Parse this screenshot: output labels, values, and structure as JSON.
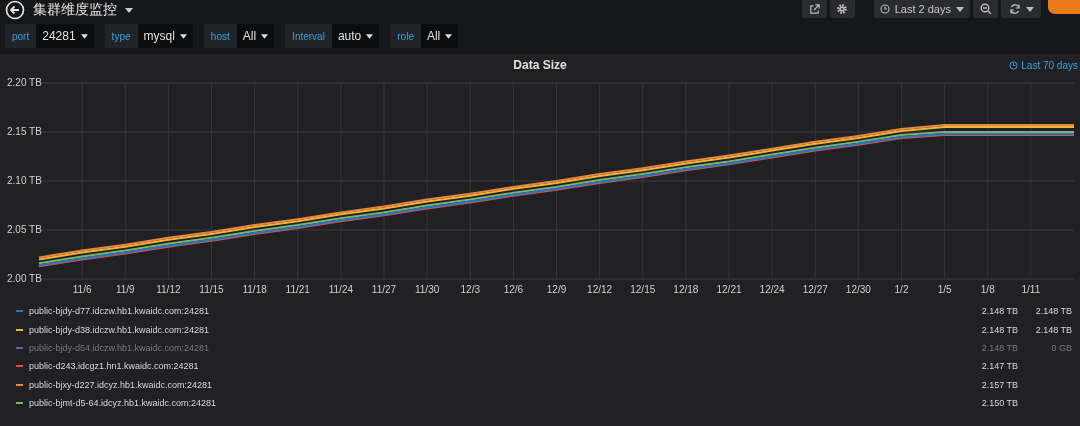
{
  "top_bar": {
    "title": "集群维度监控",
    "time_range": "Last 2 days"
  },
  "variables": [
    {
      "label": "port",
      "value": "24281"
    },
    {
      "label": "type",
      "value": "mysql"
    },
    {
      "label": "host",
      "value": "All"
    },
    {
      "label": "Interval",
      "value": "auto"
    },
    {
      "label": "role",
      "value": "All"
    }
  ],
  "panel": {
    "title": "Data Size",
    "time_override": "Last 70 days",
    "chart_data": {
      "type": "line",
      "grid": true,
      "ylim": [
        2.0,
        2.2
      ],
      "categories": [
        null,
        "11/6",
        "11/9",
        "11/12",
        "11/15",
        "11/18",
        "11/21",
        "11/24",
        "11/27",
        "11/30",
        "12/3",
        "12/6",
        "12/9",
        "12/12",
        "12/15",
        "12/18",
        "12/21",
        "12/24",
        "12/27",
        "12/30",
        "1/2",
        "1/5",
        "1/8",
        "1/11",
        null
      ],
      "yticks": [
        {
          "value": 2.0,
          "label": "2.00 TB"
        },
        {
          "value": 2.05,
          "label": "2.05 TB"
        },
        {
          "value": 2.1,
          "label": "2.10 TB"
        },
        {
          "value": 2.15,
          "label": "2.15 TB"
        },
        {
          "value": 2.2,
          "label": "2.20 TB"
        }
      ],
      "series": [
        {
          "color": "#7eb26d",
          "values": [
            2.016,
            2.023,
            2.029,
            2.036,
            2.042,
            2.049,
            2.055,
            2.062,
            2.068,
            2.075,
            2.081,
            2.088,
            2.094,
            2.101,
            2.107,
            2.114,
            2.12,
            2.127,
            2.134,
            2.14,
            2.147,
            2.15,
            2.15,
            2.15,
            2.15
          ]
        },
        {
          "color": "#eab839",
          "values": [
            2.02,
            2.027,
            2.033,
            2.04,
            2.046,
            2.053,
            2.059,
            2.066,
            2.072,
            2.079,
            2.085,
            2.092,
            2.098,
            2.105,
            2.111,
            2.118,
            2.124,
            2.131,
            2.138,
            2.144,
            2.151,
            2.155,
            2.155,
            2.155,
            2.155
          ]
        },
        {
          "color": "#ef843c",
          "values": [
            2.022,
            2.029,
            2.035,
            2.042,
            2.048,
            2.055,
            2.061,
            2.068,
            2.074,
            2.081,
            2.087,
            2.094,
            2.1,
            2.107,
            2.113,
            2.12,
            2.126,
            2.133,
            2.14,
            2.146,
            2.153,
            2.157,
            2.157,
            2.157,
            2.157
          ]
        },
        {
          "color": "#e24d42",
          "values": [
            2.013,
            2.02,
            2.026,
            2.033,
            2.039,
            2.046,
            2.052,
            2.059,
            2.065,
            2.072,
            2.078,
            2.085,
            2.091,
            2.098,
            2.104,
            2.111,
            2.117,
            2.124,
            2.131,
            2.137,
            2.144,
            2.147,
            2.147,
            2.147,
            2.147
          ]
        },
        {
          "color": "#1f78c1",
          "values": [
            2.014,
            2.021,
            2.027,
            2.034,
            2.04,
            2.047,
            2.053,
            2.06,
            2.066,
            2.073,
            2.079,
            2.086,
            2.092,
            2.099,
            2.105,
            2.112,
            2.118,
            2.125,
            2.132,
            2.138,
            2.145,
            2.148,
            2.148,
            2.148,
            2.148
          ]
        }
      ]
    },
    "legend": [
      {
        "name": "public-bjdy-d77.idczw.hb1.kwaidc.com:24281",
        "color": "#1f78c1",
        "hidden": false,
        "column_1": "2.148 TB",
        "column_2": "2.148 TB"
      },
      {
        "name": "public-bjdy-d38.idczw.hb1.kwaidc.com:24281",
        "color": "#eab839",
        "hidden": false,
        "column_1": "2.148 TB",
        "column_2": "2.148 TB"
      },
      {
        "name": "public-bjdy-d54.idczw.hb1.kwaidc.com:24281",
        "color": "#705da0",
        "hidden": true,
        "column_1": "2.148 TB",
        "column_2": "0 GB"
      },
      {
        "name": "public-d243.idcgz1.hn1.kwaidc.com:24281",
        "color": "#e24d42",
        "hidden": false,
        "column_1": "2.147 TB"
      },
      {
        "name": "public-bjxy-d227.idcyz.hb1.kwaidc.com:24281",
        "color": "#ef843c",
        "hidden": false,
        "column_1": "2.157 TB"
      },
      {
        "name": "public-bjmt-d5-64.idcyz.hb1.kwaidc.com:24281",
        "color": "#7eb26d",
        "hidden": false,
        "column_1": "2.150 TB"
      }
    ]
  }
}
